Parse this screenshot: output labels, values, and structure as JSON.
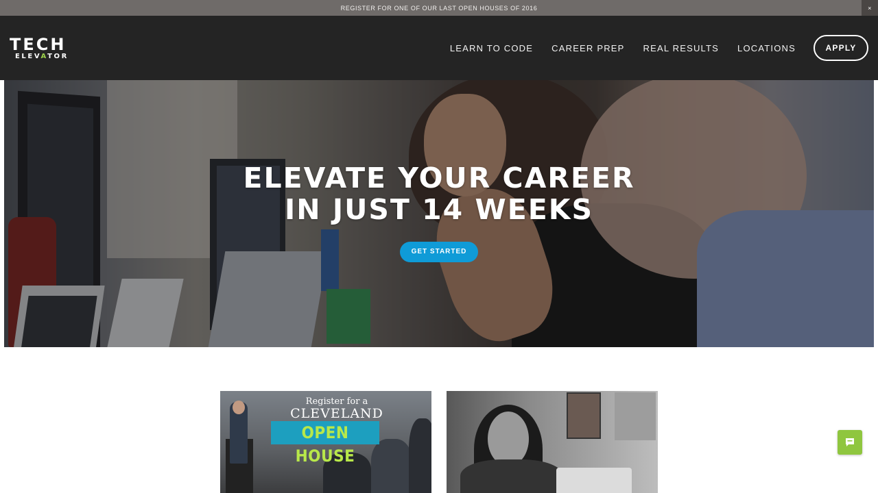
{
  "announcement": {
    "text": "REGISTER FOR ONE OF OUR LAST OPEN HOUSES OF 2016",
    "close_label": "×"
  },
  "header": {
    "logo_top": "TECH",
    "logo_bottom_a": "ELEV",
    "logo_bottom_accent": "A",
    "logo_bottom_b": "TOR",
    "nav": [
      {
        "label": "LEARN TO CODE"
      },
      {
        "label": "CAREER PREP"
      },
      {
        "label": "REAL RESULTS"
      },
      {
        "label": "LOCATIONS"
      }
    ],
    "apply_label": "APPLY"
  },
  "hero": {
    "title_line1": "ELEVATE YOUR CAREER",
    "title_line2": "IN JUST 14 WEEKS",
    "cta_label": "GET STARTED"
  },
  "cards": [
    {
      "line1": "Register for a",
      "line2": "CLEVELAND",
      "line3": "OPEN HOUSE"
    }
  ],
  "colors": {
    "header_bg": "#242424",
    "announce_bg": "#6f6b69",
    "cta_blue": "#0f9bd7",
    "logo_accent": "#9bd14b",
    "chat_green": "#8fc63f"
  },
  "icons": {
    "chat": "chat-bubble-icon",
    "close": "close-icon"
  }
}
